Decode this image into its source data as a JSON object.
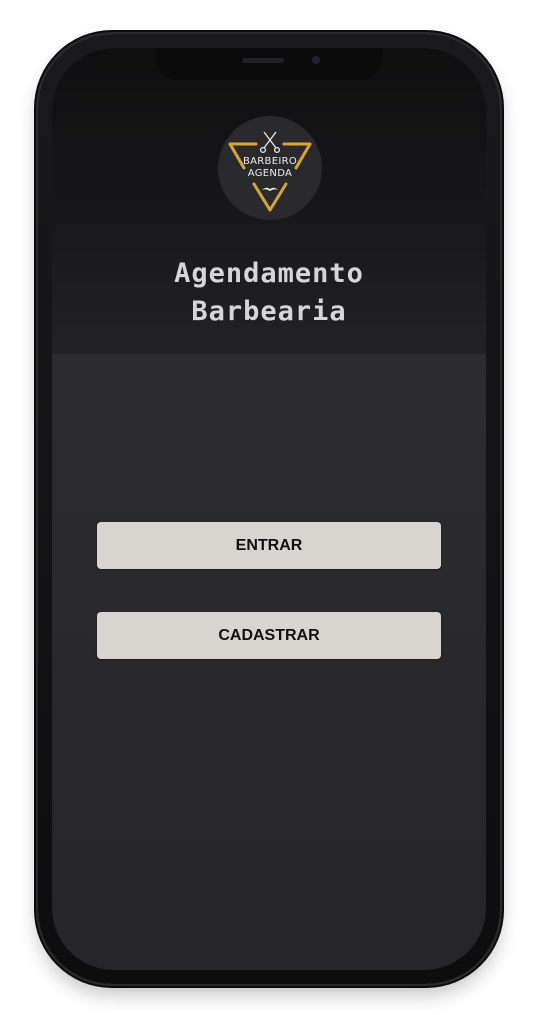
{
  "logo": {
    "line1": "BARBEIRO",
    "line2": "AGENDA",
    "icons": [
      "scissors-icon",
      "mustache-icon"
    ],
    "accent_color": "#d9a437"
  },
  "header": {
    "title_line1": "Agendamento",
    "title_line2": "Barbearia"
  },
  "actions": {
    "enter_label": "ENTRAR",
    "register_label": "CADASTRAR"
  },
  "colors": {
    "button_bg": "#d8d4d0",
    "screen_bg": "#2c2c2f",
    "title_text": "#d6d6d6"
  }
}
